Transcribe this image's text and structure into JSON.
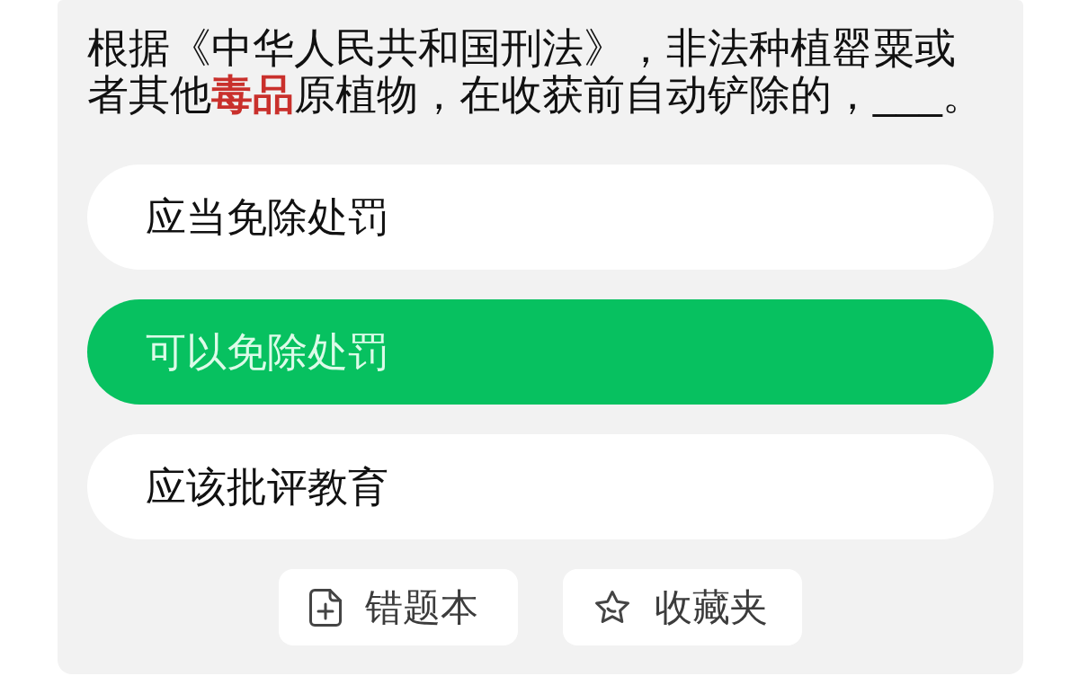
{
  "question": {
    "text": "根据《中华人民共和国刑法》，非法种植罂粟或者其他**毒品**原植物，在收获前自动铲除的，___。"
  },
  "options": [
    {
      "label": "应当免除处罚",
      "selected": false
    },
    {
      "label": "可以免除处罚",
      "selected": true
    },
    {
      "label": "应该批评教育",
      "selected": false
    }
  ],
  "actions": [
    {
      "kind": "mistakes",
      "label": "错题本"
    },
    {
      "kind": "favorites",
      "label": "收藏夹"
    }
  ]
}
